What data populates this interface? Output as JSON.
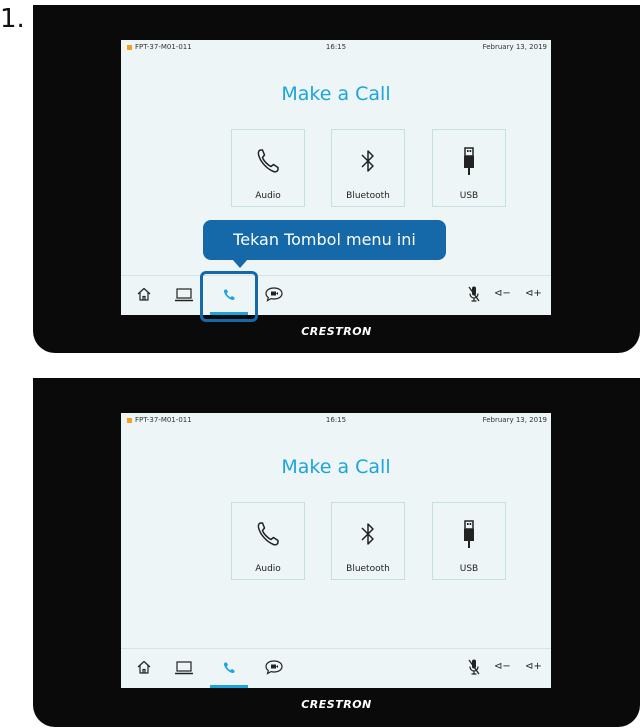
{
  "step_label": "1.",
  "screens": [
    {
      "status": {
        "room": "FPT-37-M01-011",
        "time": "16:15",
        "date": "February 13, 2019"
      },
      "title": "Make a Call",
      "tiles": [
        {
          "label": "Audio",
          "icon": "phone-icon"
        },
        {
          "label": "Bluetooth",
          "icon": "bluetooth-icon"
        },
        {
          "label": "USB",
          "icon": "usb-icon"
        }
      ],
      "nav": {
        "active": "call",
        "volume_down": "⊲−",
        "volume_up": "⊲+"
      },
      "callout": "Tekan Tombol menu ini",
      "brand": "CRESTRON"
    },
    {
      "status": {
        "room": "FPT-37-M01-011",
        "time": "16:15",
        "date": "February 13, 2019"
      },
      "title": "Make a Call",
      "tiles": [
        {
          "label": "Audio",
          "icon": "phone-icon"
        },
        {
          "label": "Bluetooth",
          "icon": "bluetooth-icon"
        },
        {
          "label": "USB",
          "icon": "usb-icon"
        }
      ],
      "nav": {
        "active": "call",
        "volume_down": "⊲−",
        "volume_up": "⊲+"
      },
      "brand": "CRESTRON"
    }
  ],
  "colors": {
    "accent": "#1ba5dd",
    "callout": "#1569a8",
    "status_indicator": "#f3a31b",
    "bezel": "#0a0a0a",
    "screen": "#eef5f6"
  }
}
